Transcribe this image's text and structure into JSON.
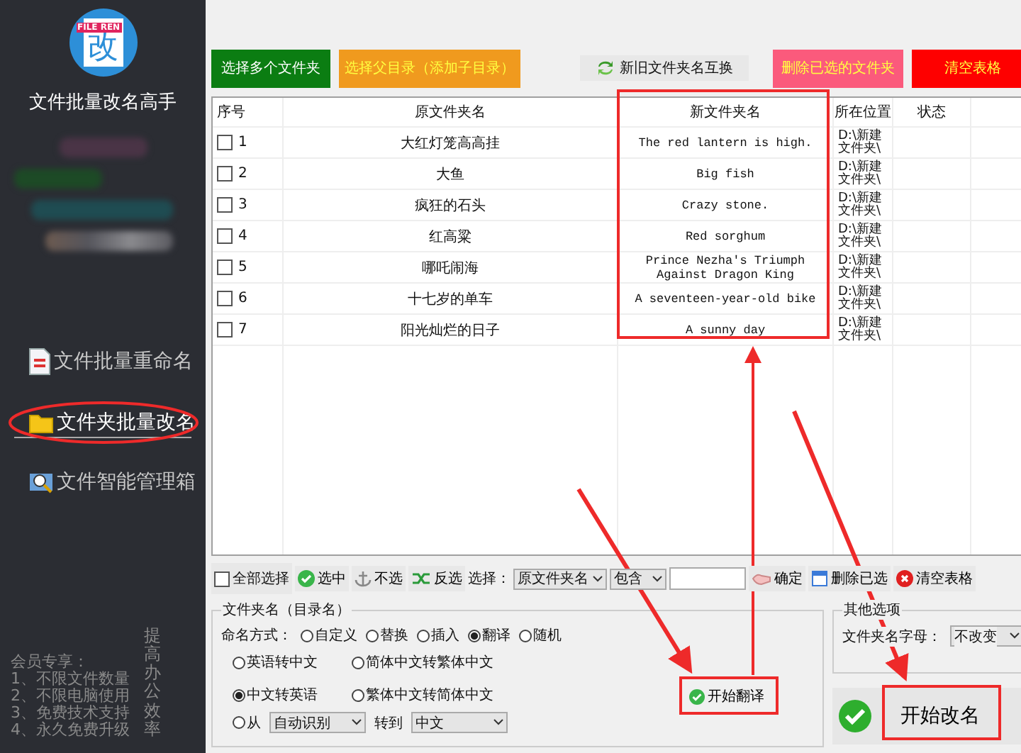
{
  "app": {
    "logo_tag": "FILE REN",
    "logo_char": "改",
    "title": "文件批量改名高手"
  },
  "sidebar": {
    "items": [
      {
        "label": "文件批量重命名",
        "kind": "doc",
        "selected": false
      },
      {
        "label": "文件夹批量改名",
        "kind": "folder",
        "selected": true
      },
      {
        "label": "文件智能管理箱",
        "kind": "search",
        "selected": false
      }
    ],
    "promo_lines": [
      "会员专享：",
      "1、不限文件数量",
      "2、不限电脑使用",
      "3、免费技术支持",
      "4、永久免费升级"
    ],
    "slogan": "提高办公效率"
  },
  "top_buttons": [
    {
      "label": "选择多个文件夹",
      "kind": "solid",
      "color": "#0b7d12"
    },
    {
      "label": "选择父目录（添加子目录）",
      "kind": "solid",
      "color": "#f09a1e"
    },
    {
      "label": "新旧文件夹名互换",
      "kind": "plain",
      "color": "#e8e8e8"
    },
    {
      "label": "删除已选的文件夹",
      "kind": "solid",
      "color": "#fb5a7c"
    },
    {
      "label": "清空表格",
      "kind": "solid",
      "color": "#fe0000"
    }
  ],
  "table": {
    "columns": [
      "序号",
      "原文件夹名",
      "新文件夹名",
      "所在位置",
      "状态"
    ],
    "rows": [
      {
        "index": "1",
        "checked": false,
        "original": "大红灯笼高高挂",
        "new": "The red lantern is high.",
        "location": "D:\\新建文件夹\\"
      },
      {
        "index": "2",
        "checked": false,
        "original": "大鱼",
        "new": "Big fish",
        "location": "D:\\新建文件夹\\"
      },
      {
        "index": "3",
        "checked": false,
        "original": "疯狂的石头",
        "new": "Crazy stone.",
        "location": "D:\\新建文件夹\\"
      },
      {
        "index": "4",
        "checked": false,
        "original": "红高粱",
        "new": "Red sorghum",
        "location": "D:\\新建文件夹\\"
      },
      {
        "index": "5",
        "checked": false,
        "original": "哪吒闹海",
        "new": "Prince Nezha's Triumph Against Dragon King",
        "location": "D:\\新建文件夹\\"
      },
      {
        "index": "6",
        "checked": false,
        "original": "十七岁的单车",
        "new": "A seventeen-year-old bike",
        "location": "D:\\新建文件夹\\"
      },
      {
        "index": "7",
        "checked": false,
        "original": "阳光灿烂的日子",
        "new": "A sunny day",
        "location": "D:\\新建文件夹\\"
      }
    ]
  },
  "selection_bar": {
    "select_all": {
      "label": "全部选择",
      "checked": false
    },
    "select": "选中",
    "deselect": "不选",
    "invert": "反选",
    "filter_label": "选择：",
    "field": "原文件夹名",
    "match": "包含",
    "confirm": "确定",
    "delete": "删除已选",
    "clear": "清空表格"
  },
  "naming": {
    "title": "文件夹名（目录名）",
    "mode_label": "命名方式：",
    "modes": [
      {
        "label": "自定义",
        "selected": false
      },
      {
        "label": "替换",
        "selected": false
      },
      {
        "label": "插入",
        "selected": false
      },
      {
        "label": "翻译",
        "selected": true
      },
      {
        "label": "随机",
        "selected": false
      }
    ],
    "directions": [
      {
        "label": "英语转中文",
        "selected": false
      },
      {
        "label": "简体中文转繁体中文",
        "selected": false
      },
      {
        "label": "中文转英语",
        "selected": true
      },
      {
        "label": "繁体中文转简体中文",
        "selected": false
      }
    ],
    "custom": {
      "label": "从",
      "selected": false,
      "from": "自动识别",
      "to_label": "转到",
      "to": "中文"
    },
    "translate_button": "开始翻译"
  },
  "other_options": {
    "title": "其他选项",
    "letter_label": "文件夹名字母：",
    "letter_value": "不改变"
  },
  "rename_button": "开始改名"
}
